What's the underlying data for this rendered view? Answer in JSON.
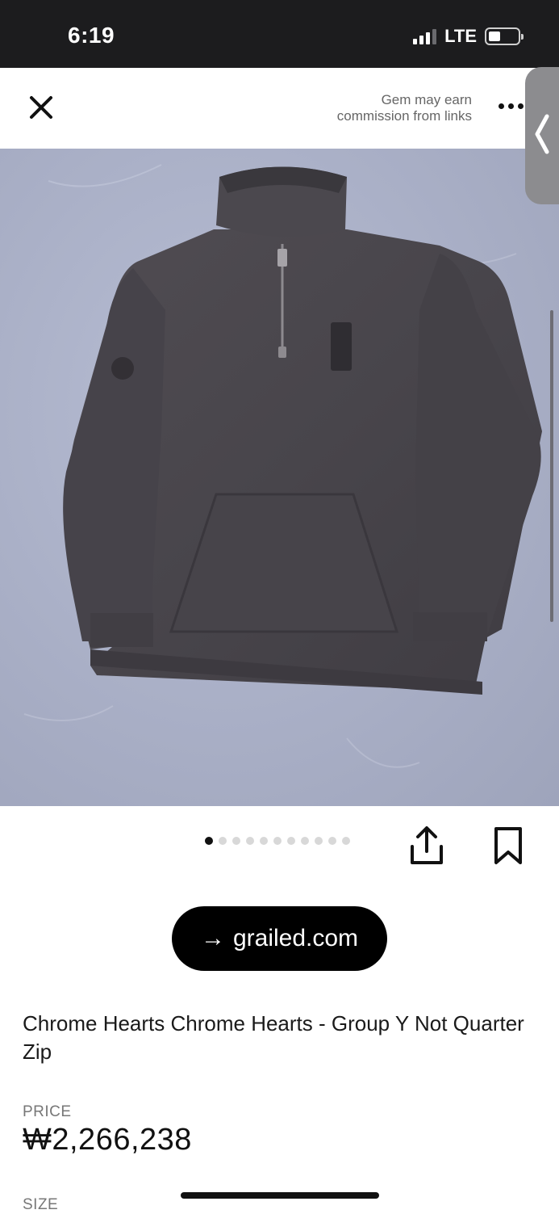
{
  "status_bar": {
    "time": "6:19",
    "network": "LTE",
    "icons": [
      "signal-icon",
      "battery-icon"
    ]
  },
  "header": {
    "close_icon": "close-icon",
    "disclaimer_line1": "Gem may earn",
    "disclaimer_line2": "commission from links",
    "more_icon": "more-icon",
    "side_handle_icon": "chevron-left-icon"
  },
  "gallery": {
    "image_count": 11,
    "active_index": 0,
    "share_icon": "share-icon",
    "save_icon": "bookmark-icon"
  },
  "store": {
    "arrow": "→",
    "domain": "grailed.com"
  },
  "product": {
    "title": "Chrome Hearts Chrome Hearts - Group Y Not Quarter Zip",
    "price_label": "PRICE",
    "price": "₩2,266,238",
    "size_label": "SIZE"
  },
  "colors": {
    "status_bar_bg": "#1c1c1e",
    "hero_bg": "#aab0c7",
    "garment": "#4a474c",
    "button_bg": "#000000"
  }
}
